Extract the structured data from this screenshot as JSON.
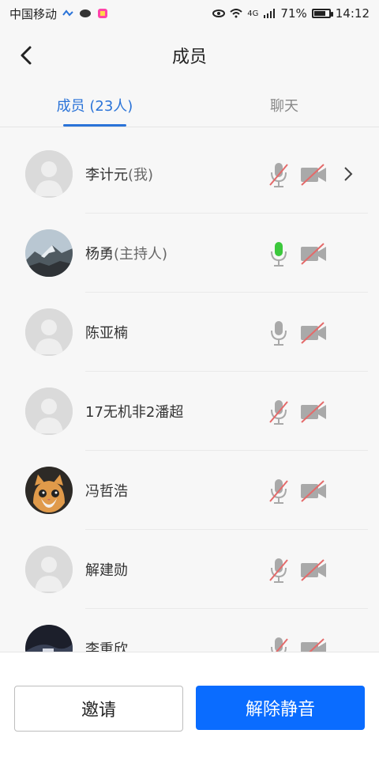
{
  "status_bar": {
    "carrier": "中国移动",
    "battery_percent": "71%",
    "time": "14:12",
    "network": "4G"
  },
  "nav": {
    "title": "成员"
  },
  "tabs": [
    {
      "label": "成员 (23人)",
      "active": true
    },
    {
      "label": "聊天",
      "active": false
    }
  ],
  "members": [
    {
      "name": "李计元",
      "suffix": "(我)",
      "mic": "muted",
      "camera": "off",
      "avatar": "default",
      "show_chevron": true
    },
    {
      "name": "杨勇",
      "suffix": "(主持人)",
      "mic": "speaking",
      "camera": "off",
      "avatar": "landscape"
    },
    {
      "name": "陈亚楠",
      "suffix": "",
      "mic": "on",
      "camera": "off",
      "avatar": "default"
    },
    {
      "name": "17无机非2潘超",
      "suffix": "",
      "mic": "muted",
      "camera": "off",
      "avatar": "default"
    },
    {
      "name": "冯哲浩",
      "suffix": "",
      "mic": "muted",
      "camera": "off",
      "avatar": "cat"
    },
    {
      "name": "解建勋",
      "suffix": "",
      "mic": "muted",
      "camera": "off",
      "avatar": "default"
    },
    {
      "name": "李重欣",
      "suffix": "",
      "mic": "muted",
      "camera": "off",
      "avatar": "dark"
    }
  ],
  "bottom": {
    "invite_label": "邀请",
    "unmute_label": "解除静音"
  },
  "colors": {
    "accent": "#2a73d8",
    "primary_button": "#0a6cff",
    "muted_red": "#e46a6a",
    "speaking_green": "#3cc83c"
  }
}
